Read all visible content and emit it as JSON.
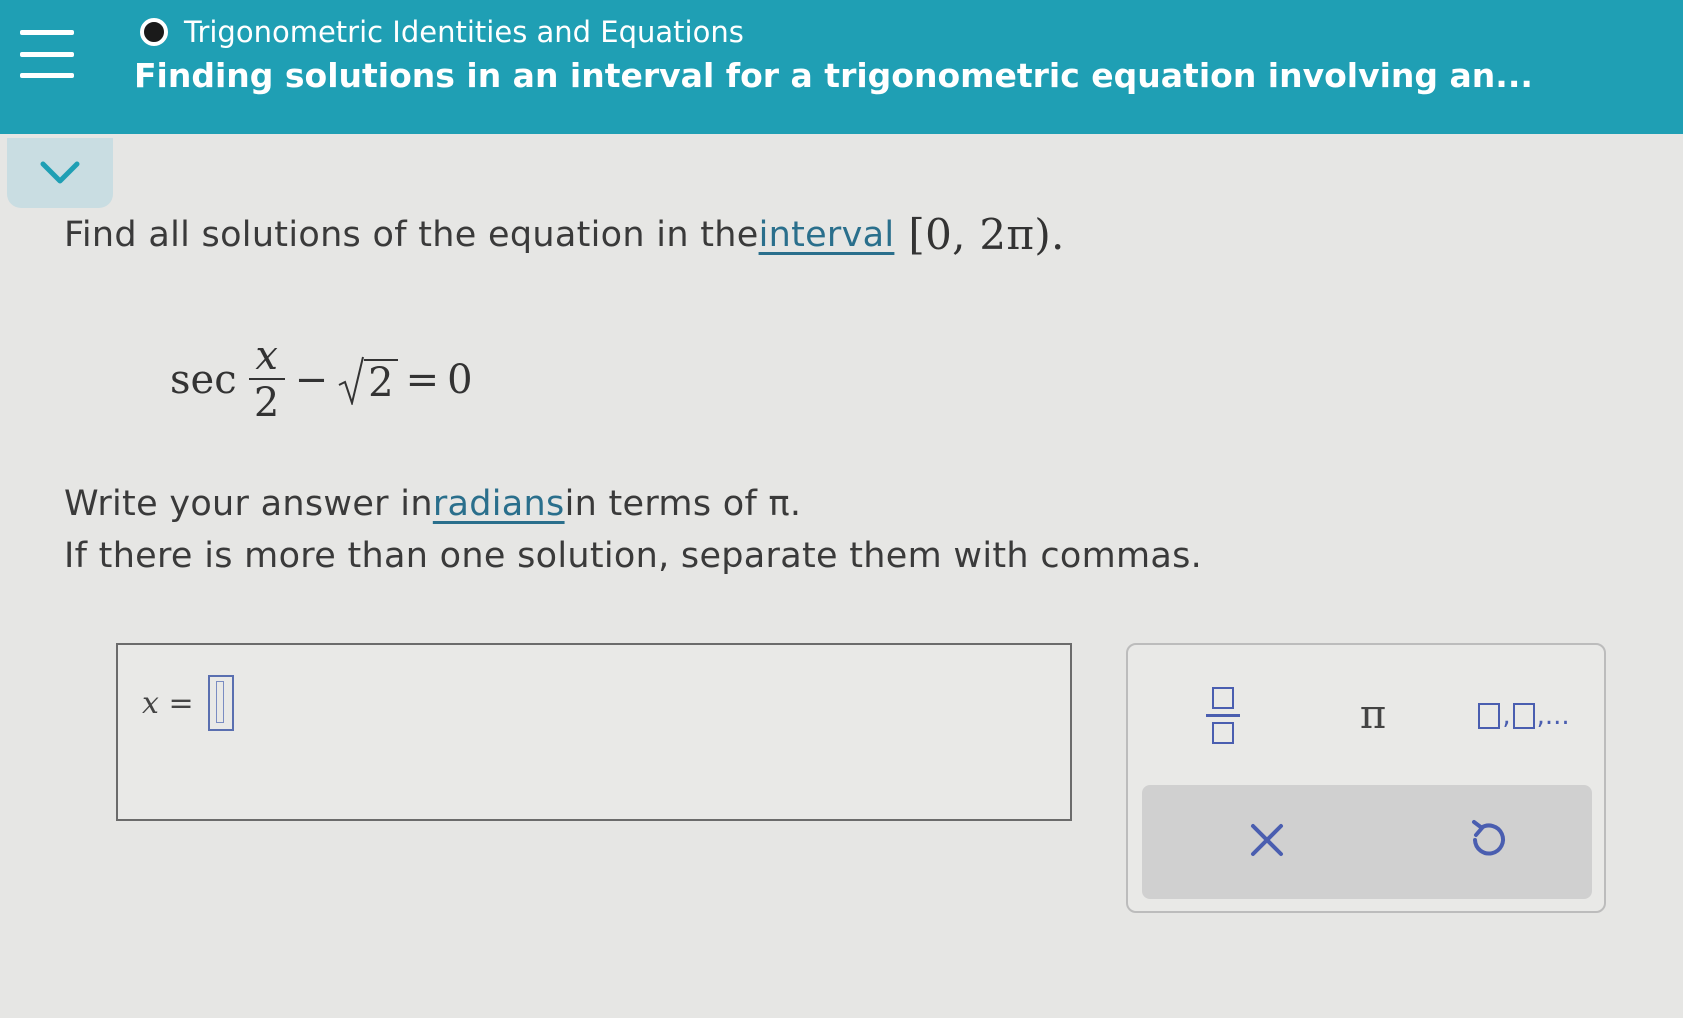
{
  "header": {
    "topic": "Trigonometric Identities and Equations",
    "title": "Finding solutions in an interval for a trigonometric equation involving an..."
  },
  "icons": {
    "menu": "hamburger-menu-icon",
    "collapse": "chevron-down-icon",
    "status": "progress-dot-icon",
    "clear": "close-icon",
    "undo": "undo-icon"
  },
  "problem": {
    "line1_prefix": "Find all solutions of the equation in the ",
    "line1_link": "interval",
    "interval_math": "[0, 2π).",
    "equation": {
      "func": "sec",
      "numerator": "x",
      "denominator": "2",
      "minus": "−",
      "radicand": "2",
      "equals": "=",
      "rhs": "0"
    },
    "line2_prefix": "Write your answer in ",
    "line2_link": "radians",
    "line2_suffix": " in terms of π.",
    "line3": "If there is more than one solution, separate them with commas."
  },
  "answer": {
    "label": "x =",
    "value": ""
  },
  "keypad": {
    "pi_label": "π",
    "list_separator": ",",
    "list_ellipsis": ",..."
  },
  "colors": {
    "header_bg": "#1f9fb4",
    "link": "#2a6f8c",
    "keypad_accent": "#4a5eb0"
  }
}
